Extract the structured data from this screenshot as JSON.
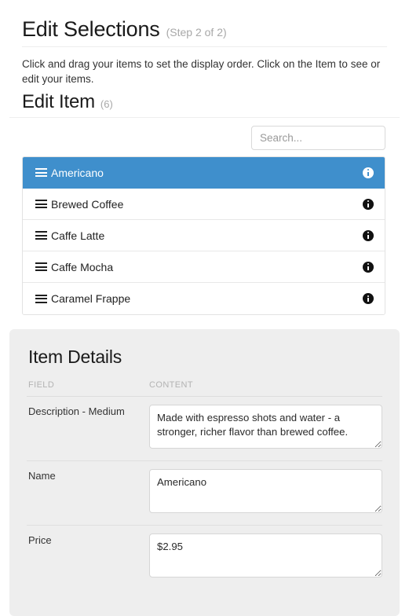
{
  "header": {
    "title": "Edit Selections",
    "step": "(Step 2 of 2)",
    "instructions": "Click and drag your items to set the display order. Click on the Item to see or edit your items."
  },
  "section": {
    "title": "Edit Item",
    "count": "(6)"
  },
  "search": {
    "placeholder": "Search...",
    "value": ""
  },
  "item_list": {
    "selected_index": 0,
    "items": [
      {
        "label": "Americano",
        "drag_icon": "hamburger-drag-icon",
        "info_icon": "info-icon"
      },
      {
        "label": "Brewed Coffee",
        "drag_icon": "hamburger-drag-icon",
        "info_icon": "info-icon"
      },
      {
        "label": "Caffe Latte",
        "drag_icon": "hamburger-drag-icon",
        "info_icon": "info-icon"
      },
      {
        "label": "Caffe Mocha",
        "drag_icon": "hamburger-drag-icon",
        "info_icon": "info-icon"
      },
      {
        "label": "Caramel Frappe",
        "drag_icon": "hamburger-drag-icon",
        "info_icon": "info-icon"
      }
    ]
  },
  "details": {
    "title": "Item Details",
    "columns": {
      "field": "FIELD",
      "content": "CONTENT"
    },
    "rows": [
      {
        "field": "Description - Medium",
        "content": "Made with espresso shots and water - a stronger, richer flavor than brewed coffee."
      },
      {
        "field": "Name",
        "content": "Americano"
      },
      {
        "field": "Price",
        "content": "$2.95"
      }
    ]
  },
  "colors": {
    "selected_row": "#3f8fcc",
    "panel_background": "#eeeeee",
    "page_background": "#ffffff",
    "muted_text": "#a8a8a8"
  }
}
